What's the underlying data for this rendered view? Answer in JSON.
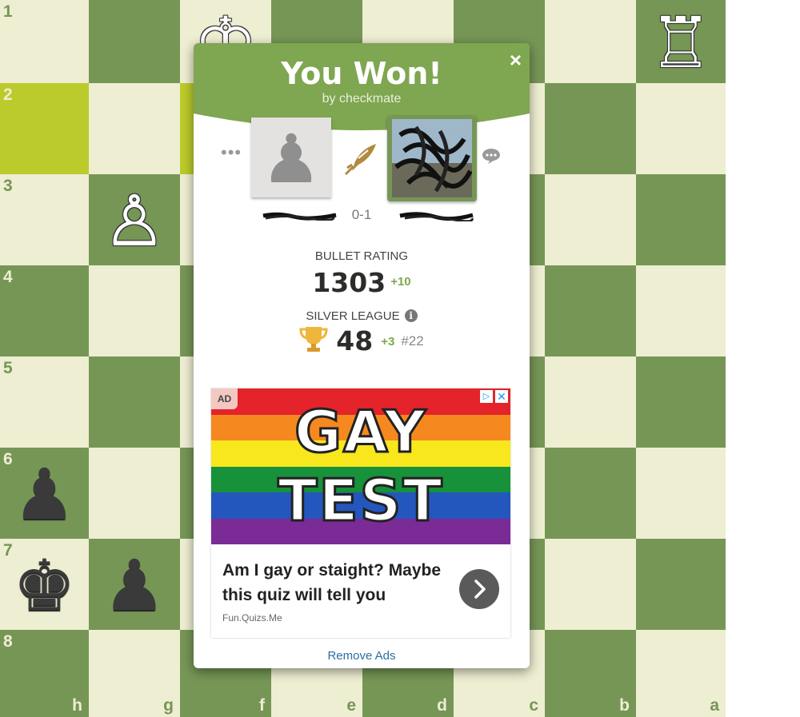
{
  "board": {
    "ranks": [
      "1",
      "2",
      "3",
      "4",
      "5",
      "6",
      "7",
      "8"
    ],
    "files": [
      "h",
      "g",
      "f",
      "e",
      "d",
      "c",
      "b",
      "a"
    ],
    "pieces": {
      "king_white": "♔",
      "rook_white": "♖",
      "pawn_white": "♙",
      "pawn_black": "♟",
      "king_black": "♚"
    },
    "colors": {
      "light": "#eeeed2",
      "dark": "#769656",
      "highlight": "#bbcb2b"
    }
  },
  "modal": {
    "title": "You Won!",
    "subtitle": "by checkmate",
    "close_symbol": "×",
    "more_symbol": "•••",
    "score": "0-1",
    "rating_label": "BULLET RATING",
    "rating_value": "1303",
    "rating_delta": "+10",
    "league_label": "SILVER LEAGUE",
    "info_symbol": "i",
    "league_points": "48",
    "league_delta": "+3",
    "league_rank": "#22",
    "header_color": "#7fa650",
    "icons": {
      "bullet": "bullet-rocket-icon",
      "chat": "chat-bubble-icon",
      "trophy": "trophy-icon",
      "info": "info-icon",
      "close": "close-icon"
    }
  },
  "ad": {
    "badge": "AD",
    "adchoices_symbol": "▷",
    "close_symbol": "✕",
    "banner_line1": "GAY",
    "banner_line2": "TEST",
    "headline": "Am I gay or staight? Maybe this quiz will tell you",
    "source": "Fun.Quizs.Me",
    "cta_icon": "chevron-right-icon"
  },
  "remove_ads": "Remove Ads"
}
